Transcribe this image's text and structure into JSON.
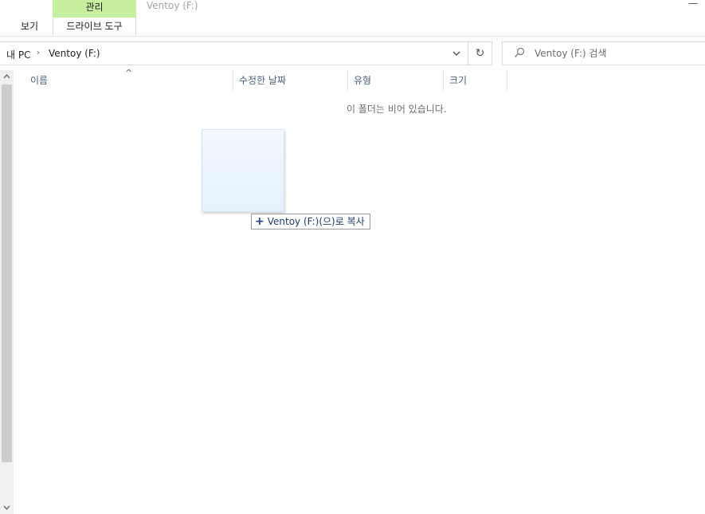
{
  "ribbon": {
    "context_group": "관리",
    "window_title": "Ventoy (F:)",
    "minimize_label": "—",
    "tabs": [
      {
        "label": "보기"
      },
      {
        "label": "드라이브 도구"
      }
    ]
  },
  "address": {
    "root": "내 PC",
    "separator": "›",
    "current": "Ventoy (F:)",
    "dropdown_icon": "chevron-down-icon",
    "refresh_icon": "refresh-icon"
  },
  "search": {
    "placeholder": "Ventoy (F:) 검색",
    "icon": "search-icon"
  },
  "columns": [
    {
      "label": "이름"
    },
    {
      "label": "수정한 날짜"
    },
    {
      "label": "유형"
    },
    {
      "label": "크기"
    }
  ],
  "sort": {
    "column": "이름",
    "indicator": "^"
  },
  "empty_message": "이 폴더는 비어 있습니다.",
  "drag": {
    "operation_icon": "+",
    "tooltip": "Ventoy (F:)(으)로 복사"
  },
  "colors": {
    "context_tab": "#c6efa0",
    "header_text": "#4c607a",
    "scroll_thumb": "#cdcdcd"
  }
}
